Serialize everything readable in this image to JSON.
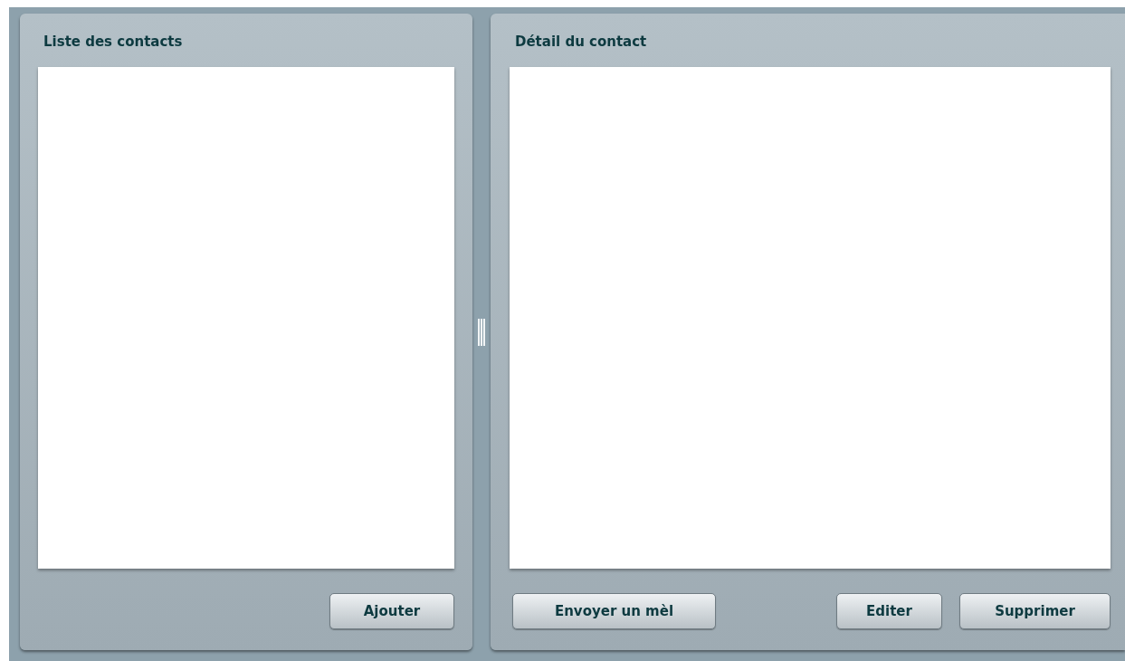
{
  "panels": [
    {
      "title": "Liste des contacts",
      "buttons_right": [
        "Ajouter"
      ]
    },
    {
      "title": "Détail du contact",
      "buttons_left": [
        "Envoyer un mèl"
      ],
      "buttons_right": [
        "Editer",
        "Supprimer"
      ]
    }
  ]
}
